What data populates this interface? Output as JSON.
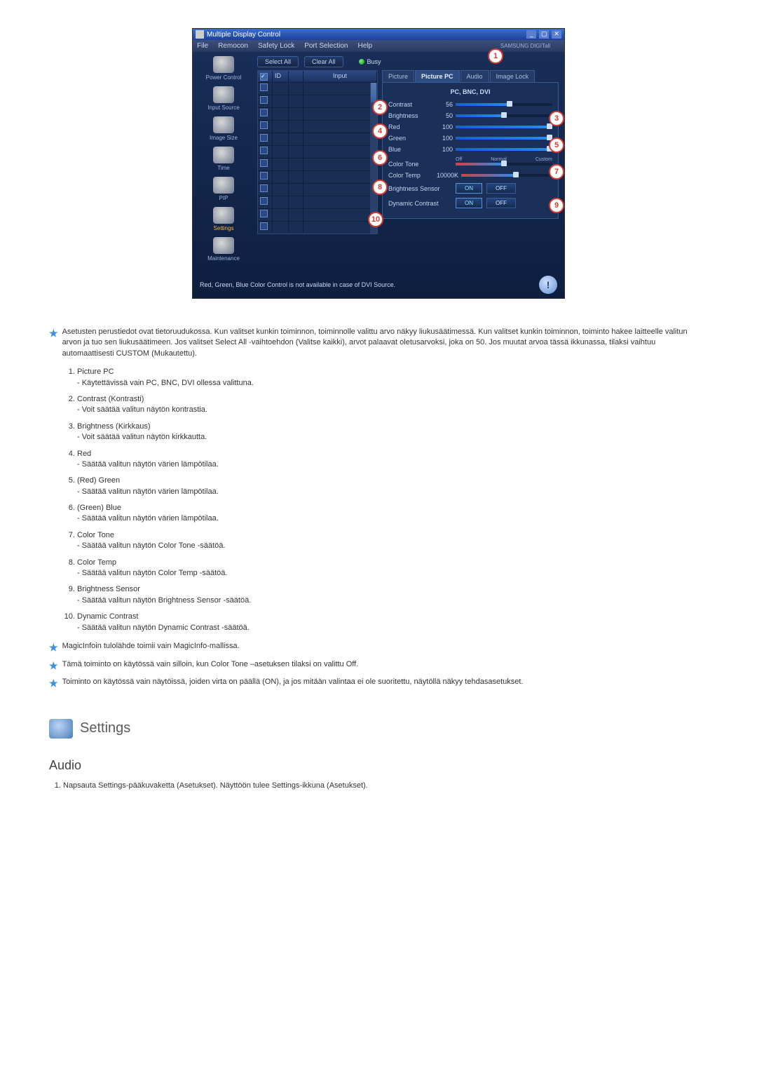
{
  "window": {
    "title": "Multiple Display Control",
    "menu": [
      "File",
      "Remocon",
      "Safety Lock",
      "Port Selection",
      "Help"
    ],
    "brand": "SAMSUNG DIGITall"
  },
  "sidebar": {
    "items": [
      {
        "label": "Power Control"
      },
      {
        "label": "Input Source"
      },
      {
        "label": "Image Size"
      },
      {
        "label": "Time"
      },
      {
        "label": "PIP"
      },
      {
        "label": "Settings"
      },
      {
        "label": "Maintenance"
      }
    ]
  },
  "topControls": {
    "selectAll": "Select All",
    "clearAll": "Clear All",
    "busy": "Busy"
  },
  "grid": {
    "headers": {
      "chk": "✓",
      "id": "ID",
      "u": "",
      "input": "Input"
    }
  },
  "tabs": [
    "Picture",
    "Picture PC",
    "Audio",
    "Image Lock"
  ],
  "panel": {
    "subtitle": "PC, BNC, DVI",
    "contrast": {
      "label": "Contrast",
      "value": 56
    },
    "brightness": {
      "label": "Brightness",
      "value": 50
    },
    "red": {
      "label": "Red",
      "value": 100
    },
    "green": {
      "label": "Green",
      "value": 100
    },
    "blue": {
      "label": "Blue",
      "value": 100
    },
    "colorTone": {
      "label": "Color Tone",
      "opts": [
        "Off",
        "Normal",
        "Custom"
      ]
    },
    "colorTemp": {
      "label": "Color Temp",
      "value": "10000K"
    },
    "brSensor": {
      "label": "Brightness Sensor",
      "on": "ON",
      "off": "OFF"
    },
    "dynContrast": {
      "label": "Dynamic Contrast",
      "on": "ON",
      "off": "OFF"
    }
  },
  "statusText": "Red, Green, Blue Color Control is not available in case of DVI Source.",
  "callouts": [
    "1",
    "2",
    "3",
    "4",
    "5",
    "6",
    "7",
    "8",
    "9",
    "10"
  ],
  "notes": {
    "intro": "Asetusten perustiedot ovat tietoruudukossa. Kun valitset kunkin toiminnon, toiminnolle valittu arvo näkyy liukusäätimessä. Kun valitset kunkin toiminnon, toiminto hakee laitteelle valitun arvon ja tuo sen liukusäätimeen. Jos valitset Select All -vaihtoehdon (Valitse kaikki), arvot palaavat oletusarvoksi, joka on 50. Jos muutat arvoa tässä ikkunassa, tilaksi vaihtuu automaattisesti CUSTOM (Mukautettu).",
    "list": [
      {
        "t": "Picture PC",
        "d": "- Käytettävissä vain PC, BNC, DVI ollessa valittuna."
      },
      {
        "t": "Contrast (Kontrasti)",
        "d": "- Voit säätää valitun näytön kontrastia."
      },
      {
        "t": "Brightness (Kirkkaus)",
        "d": "- Voit säätää valitun näytön kirkkautta."
      },
      {
        "t": "Red",
        "d": "- Säätää valitun näytön värien lämpötilaa."
      },
      {
        "t": "(Red) Green",
        "d": "- Säätää valitun näytön värien lämpötilaa."
      },
      {
        "t": "(Green) Blue",
        "d": "- Säätää valitun näytön värien lämpötilaa."
      },
      {
        "t": "Color Tone",
        "d": "- Säätää valitun näytön Color Tone -säätöä."
      },
      {
        "t": "Color Temp",
        "d": "- Säätää valitun näytön Color Temp -säätöä."
      },
      {
        "t": "Brightness Sensor",
        "d": "- Säätää valitun näytön Brightness Sensor -säätöä."
      },
      {
        "t": "Dynamic Contrast",
        "d": "- Säätää valitun näytön Dynamic Contrast -säätöä."
      }
    ],
    "star2": "MagicInfoin tulolähde toimii vain MagicInfo-mallissa.",
    "star3": "Tämä toiminto on käytössä vain silloin, kun Color Tone –asetuksen tilaksi on valittu Off.",
    "star4": "Toiminto on käytössä vain näytöissä, joiden virta on päällä (ON), ja jos mitään valintaa ei ole suoritettu, näytöllä näkyy tehdasasetukset."
  },
  "section": {
    "title": "Settings",
    "sub": "Audio",
    "step1": "Napsauta Settings-pääkuvaketta (Asetukset). Näyttöön tulee Settings-ikkuna (Asetukset)."
  }
}
